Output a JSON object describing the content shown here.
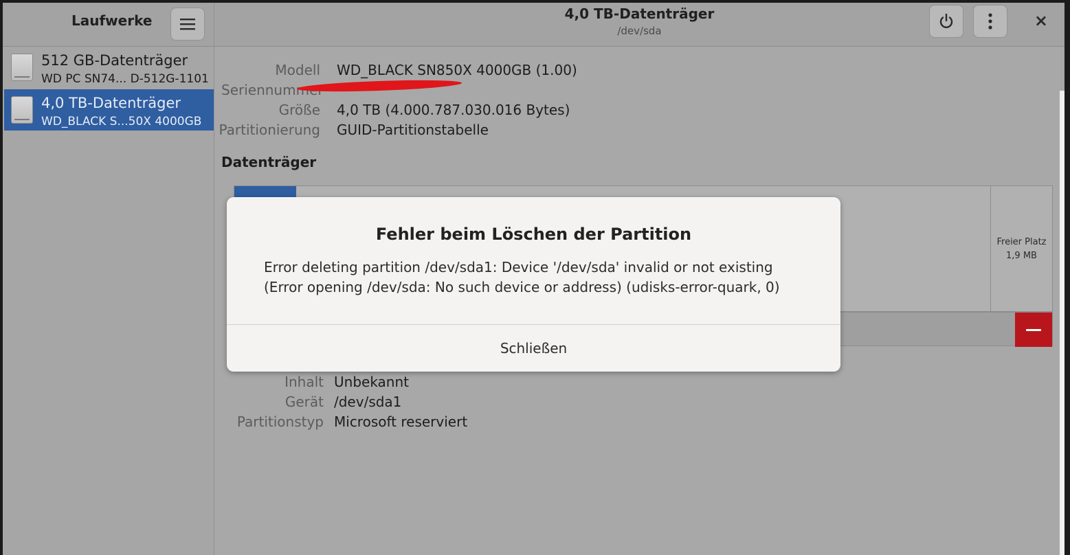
{
  "sidebar": {
    "title": "Laufwerke",
    "menu_icon": "hamburger-menu-icon",
    "drives": [
      {
        "name": "512 GB-Datenträger",
        "model": "WD PC SN74...  D-512G-1101",
        "icon": "drive-icon",
        "selected": false
      },
      {
        "name": "4,0 TB-Datenträger",
        "model": "WD_BLACK S...50X 4000GB",
        "icon": "drive-icon",
        "selected": true
      }
    ]
  },
  "header": {
    "title": "4,0 TB-Datenträger",
    "subtitle": "/dev/sda",
    "power_icon": "power-icon",
    "menu_icon": "vertical-dots-icon",
    "close_label": "×"
  },
  "details": {
    "model_label": "Modell",
    "model_value": "WD_BLACK SN850X 4000GB (1.00)",
    "serial_label": "Seriennummer",
    "size_label": "Größe",
    "size_value": "4,0 TB (4.000.787.030.016 Bytes)",
    "partitioning_label": "Partitionierung",
    "partitioning_value": "GUID-Partitionstabelle"
  },
  "volumes": {
    "section_title": "Datenträger",
    "free_space_label": "Freier Platz",
    "free_space_size": "1,9 MB",
    "delete_icon": "minus-icon",
    "content_label": "Inhalt",
    "content_value": "Unbekannt",
    "device_label": "Gerät",
    "device_value": "/dev/sda1",
    "parttype_label": "Partitionstyp",
    "parttype_value": "Microsoft reserviert"
  },
  "dialog": {
    "title": "Fehler beim Löschen der Partition",
    "message": "Error deleting partition /dev/sda1: Device '/dev/sda' invalid or not existing (Error opening /dev/sda: No such device or address) (udisks-error-quark, 0)",
    "close_button": "Schließen"
  },
  "colors": {
    "selection": "#2f5ea1",
    "delete_button": "#b8161c",
    "redaction": "#e0161b"
  }
}
